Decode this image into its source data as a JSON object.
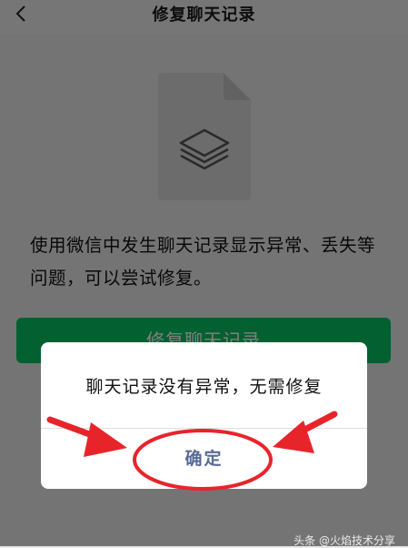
{
  "header": {
    "title": "修复聊天记录",
    "back_icon": "chevron-left-icon"
  },
  "content": {
    "icon": "layers-file-icon",
    "description_line1": "使用微信中发生聊天记录显示异常、丢失等",
    "description_line2": "问题，可以尝试修复。",
    "repair_button": "修复聊天记录"
  },
  "dialog": {
    "message": "聊天记录没有异常，无需修复",
    "confirm_label": "确定"
  },
  "colors": {
    "primary_green": "#07c160",
    "link_blue": "#576b95",
    "annotation_red": "#e8242b"
  },
  "watermark": "头条 @火焰技术分享"
}
